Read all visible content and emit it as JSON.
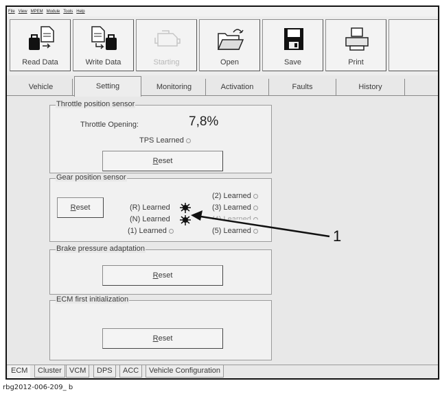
{
  "menu": [
    "File",
    "View",
    "MPEM",
    "Module",
    "Tools",
    "Help"
  ],
  "toolbar": {
    "read_data": "Read Data",
    "write_data": "Write Data",
    "starting": "Starting",
    "open": "Open",
    "save": "Save",
    "print": "Print"
  },
  "tabs": [
    "Vehicle",
    "Setting",
    "Monitoring",
    "Activation",
    "Faults",
    "History"
  ],
  "throttle": {
    "title": "Throttle position sensor",
    "opening_label": "Throttle Opening:",
    "opening_value": "7,8%",
    "tps_learned": "TPS Learned",
    "reset": "Reset"
  },
  "gear": {
    "title": "Gear position sensor",
    "reset": "Reset",
    "r_learned": "(R) Learned",
    "n_learned": "(N) Learned",
    "one_learned": "(1) Learned",
    "two_learned": "(2) Learned",
    "three_learned": "(3) Learned",
    "four_learned": "(4) Learned",
    "five_learned": "(5) Learned"
  },
  "brake": {
    "title": "Brake pressure adaptation",
    "reset": "Reset"
  },
  "ecm_init": {
    "title": "ECM first initialization",
    "reset": "Reset"
  },
  "bottom_tabs": [
    "ECM",
    "Cluster",
    "VCM",
    "DPS",
    "ACC",
    "Vehicle Configuration"
  ],
  "callout": "1",
  "caption": "rbg2012-006-209_ b"
}
